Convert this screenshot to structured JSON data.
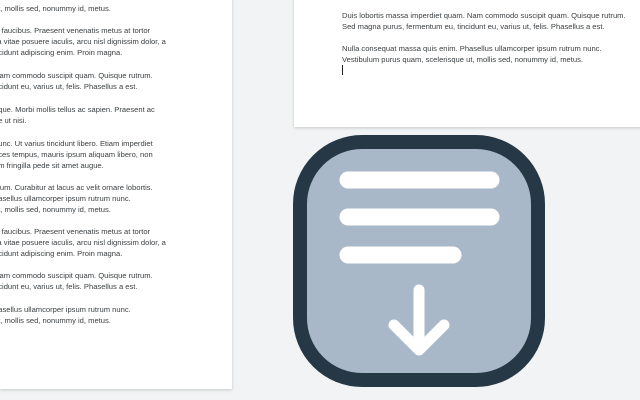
{
  "left_page": {
    "paragraphs": [
      {
        "lines": [
          "ut, mollis sed, nonummy id, metus."
        ]
      },
      {
        "lines": [
          "is faucibus. Praesent venenatis metus at tortor",
          "lla vitae posuere iaculis, arcu nisl dignissim dolor, a",
          "ncidunt adipiscing enim. Proin magna."
        ]
      },
      {
        "lines": [
          "Nam commodo suscipit quam. Quisque rutrum.",
          "ncidunt eu, varius ut, felis. Phasellus a est."
        ]
      },
      {
        "lines": [
          "eque. Morbi mollis tellus ac sapien. Praesent ac",
          "ue ut nisi."
        ]
      },
      {
        "lines": [
          "nunc. Ut varius tincidunt libero. Etiam imperdiet",
          "rices tempus, mauris ipsum aliquam libero, non",
          "um fringilla pede sit amet augue."
        ]
      },
      {
        "lines": [
          "ulum. Curabitur at lacus ac velit ornare lobortis.",
          "hasellus ullamcorper ipsum rutrum nunc.",
          "ut, mollis sed, nonummy id, metus."
        ]
      },
      {
        "lines": [
          "is faucibus. Praesent venenatis metus at tortor",
          "lla vitae posuere iaculis, arcu nisl dignissim dolor, a",
          "ncidunt adipiscing enim. Proin magna."
        ]
      },
      {
        "lines": [
          "Nam commodo suscipit quam. Quisque rutrum.",
          "ncidunt eu, varius ut, felis. Phasellus a est."
        ]
      },
      {
        "lines": [
          "hasellus ullamcorper ipsum rutrum nunc.",
          "ut, mollis sed, nonummy id, metus."
        ]
      }
    ]
  },
  "right_page": {
    "paragraphs": [
      {
        "lines": [
          "Duis lobortis massa imperdiet quam. Nam commodo suscipit quam. Quisque rutrum.",
          "Sed magna purus, fermentum eu, tincidunt eu, varius ut, felis. Phasellus a est."
        ]
      },
      {
        "lines": [
          "Nulla consequat massa quis enim. Phasellus ullamcorper ipsum rutrum nunc.",
          "Vestibulum purus quam, scelerisque ut, mollis sed, nonummy id, metus."
        ]
      }
    ]
  },
  "icon": {
    "name": "document-download-icon",
    "outline_color": "#263845",
    "fill_color": "#a9b8c9",
    "glyph_color": "#ffffff"
  }
}
